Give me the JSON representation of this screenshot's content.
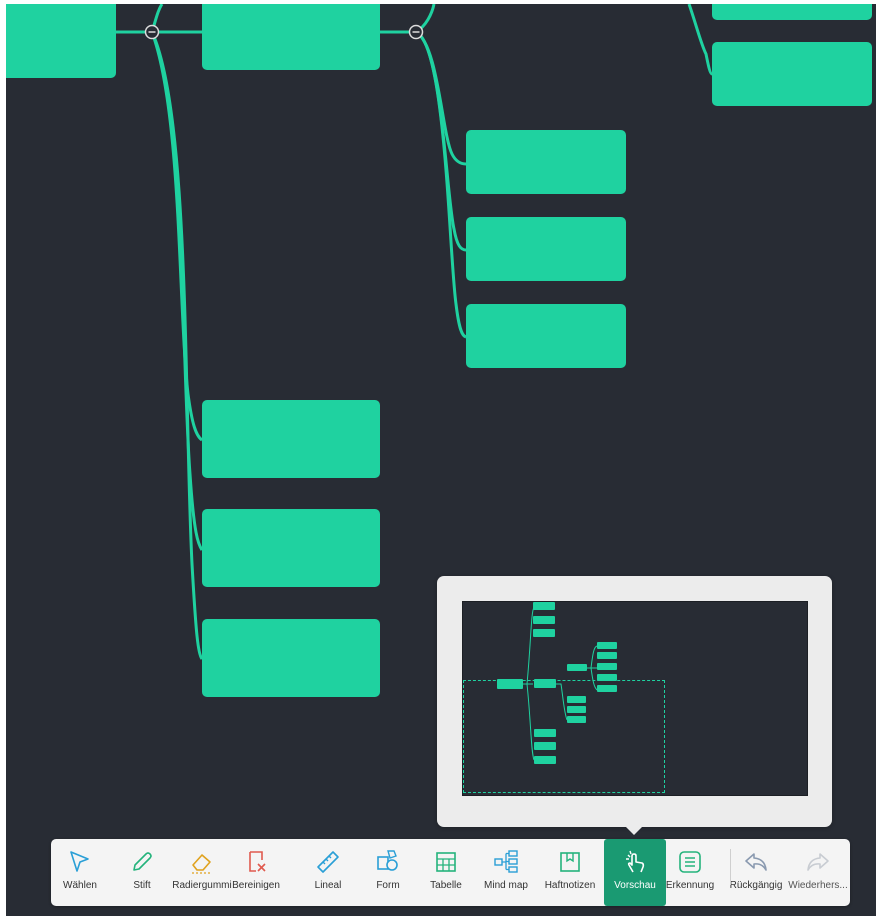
{
  "colors": {
    "canvas_bg": "#282c34",
    "node_fill": "#1fd2a0",
    "connector": "#1fd2a0",
    "active_tool_bg": "#1a9a72"
  },
  "toolbar": {
    "tools": [
      {
        "id": "select",
        "label": "Wählen",
        "icon": "cursor-arrow-icon",
        "color": "#2a9fd6"
      },
      {
        "id": "pen",
        "label": "Stift",
        "icon": "pencil-icon",
        "color": "#24b37c"
      },
      {
        "id": "eraser",
        "label": "Radiergummi",
        "icon": "eraser-icon",
        "color": "#e0a21e"
      },
      {
        "id": "clear",
        "label": "Bereinigen",
        "icon": "clear-page-icon",
        "color": "#e05a4e"
      },
      {
        "id": "ruler",
        "label": "Lineal",
        "icon": "ruler-icon",
        "color": "#2a9fd6"
      },
      {
        "id": "shape",
        "label": "Form",
        "icon": "shapes-icon",
        "color": "#2a9fd6"
      },
      {
        "id": "table",
        "label": "Tabelle",
        "icon": "table-icon",
        "color": "#24b37c"
      },
      {
        "id": "mindmap",
        "label": "Mind map",
        "icon": "mind-map-icon",
        "color": "#2a9fd6"
      },
      {
        "id": "sticky",
        "label": "Haftnotizen",
        "icon": "sticky-note-icon",
        "color": "#24b37c"
      },
      {
        "id": "preview",
        "label": "Vorschau",
        "icon": "touch-hand-icon",
        "color": "#ffffff",
        "active": true
      },
      {
        "id": "recognize",
        "label": "Erkennung",
        "icon": "text-recognition-icon",
        "color": "#24b37c"
      },
      {
        "id": "undo",
        "label": "Rückgängig",
        "icon": "undo-icon",
        "color": "#8a9ab0"
      },
      {
        "id": "redo",
        "label": "Wiederhers...",
        "icon": "redo-icon",
        "color": "#c8ccd2",
        "disabled": true
      }
    ]
  },
  "canvas": {
    "collapse_symbol": "−"
  }
}
